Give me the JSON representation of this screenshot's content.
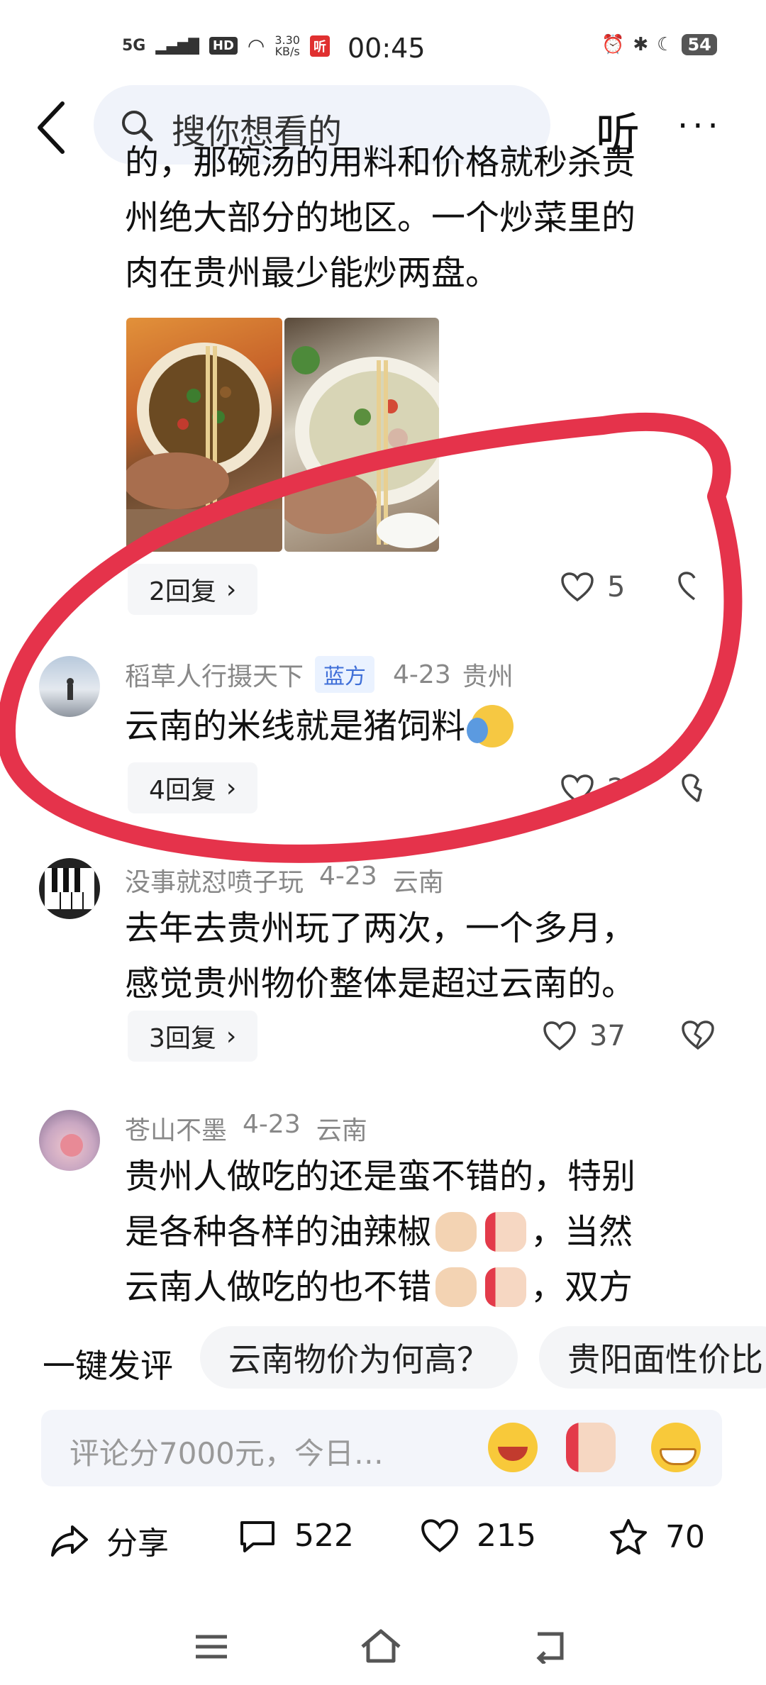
{
  "status": {
    "network": "5G",
    "hd": "HD",
    "speed_value": "3.30",
    "speed_unit": "KB/s",
    "app_badge": "听",
    "time": "00:45",
    "battery": "54"
  },
  "top": {
    "search_placeholder": "搜你想看的",
    "listen": "听",
    "more": "···"
  },
  "post": {
    "text_line1": "的，那碗汤的用料和价格就秒杀贵",
    "text_line2": "州绝大部分的地区。一个炒菜里的",
    "text_line3": "肉在贵州最少能炒两盘。",
    "replies": "2回复",
    "likes": "5"
  },
  "comments": [
    {
      "user": "稻草人行摄天下",
      "tag": "蓝方",
      "date": "4-23",
      "location": "贵州",
      "text": "云南的米线就是猪饲料",
      "replies": "4回复",
      "likes": "2"
    },
    {
      "user": "没事就怼喷子玩",
      "date": "4-23",
      "location": "云南",
      "text_line1": "去年去贵州玩了两次，一个多月，",
      "text_line2": "感觉贵州物价整体是超过云南的。",
      "replies": "3回复",
      "likes": "37"
    },
    {
      "user": "苍山不墨",
      "date": "4-23",
      "location": "云南",
      "text_line1": "贵州人做吃的还是蛮不错的，特别",
      "text_line2a": "是各种各样的油辣椒",
      "text_line2b": "，当然",
      "text_line3a": "云南人做吃的也不错",
      "text_line3b": "，双方"
    }
  ],
  "suggestions": [
    "一键发评",
    "云南物价为何高？",
    "贵阳面性价比"
  ],
  "comment_box": {
    "placeholder": "评论分7000元，今日…"
  },
  "actions": {
    "share": "分享",
    "comments": "522",
    "likes": "215",
    "favorites": "70"
  },
  "colors": {
    "annotation_circle": "#e5334b",
    "tag_blue": "#3f6fd8"
  }
}
